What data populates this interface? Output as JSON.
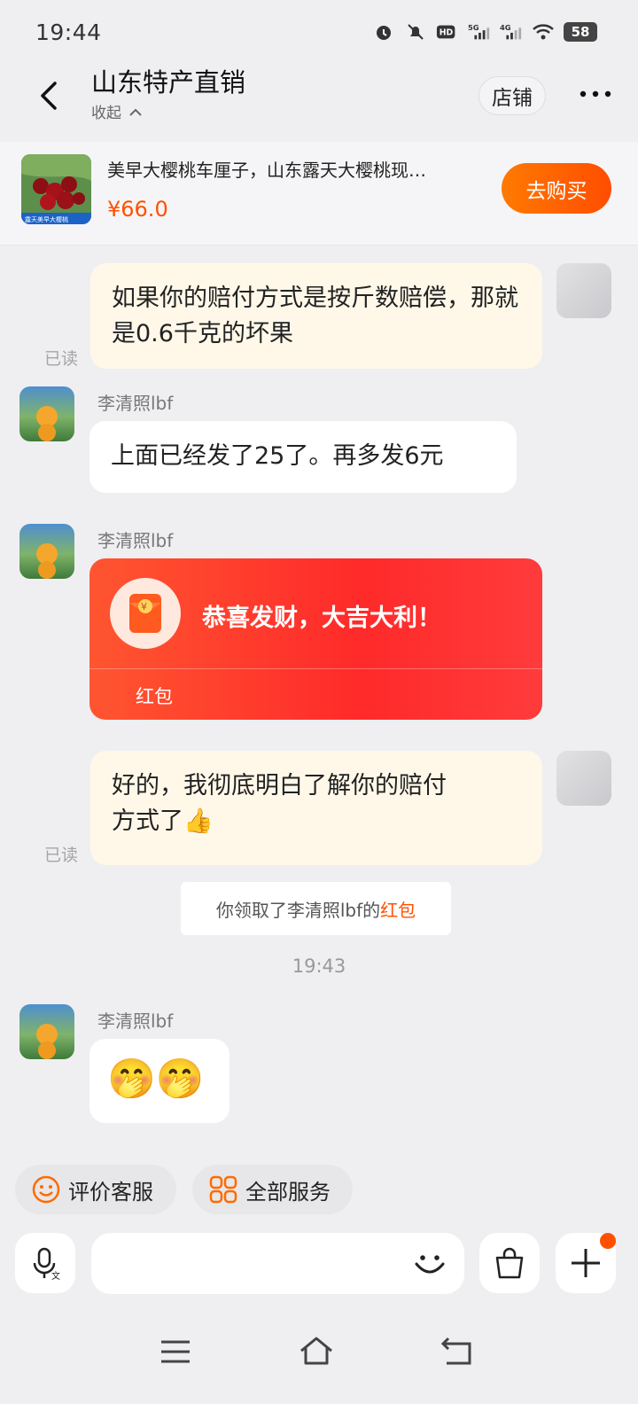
{
  "status": {
    "time": "19:44",
    "battery": "58",
    "net1": "5G",
    "net2": "4G"
  },
  "header": {
    "title": "山东特产直销",
    "subtitle": "收起",
    "shop_button": "店铺"
  },
  "product": {
    "name": "美早大樱桃车厘子，山东露天大樱桃现…",
    "price": "¥66.0",
    "buy_button": "去购买",
    "image_caption": "露天美早大樱桃"
  },
  "messages": {
    "m1": {
      "text": "如果你的赔付方式是按斤数赔偿，那就是0.6千克的坏果",
      "read": "已读"
    },
    "m2": {
      "sender": "李清照lbf",
      "text": "上面已经发了25了。再多发6元"
    },
    "m3": {
      "sender": "李清照lbf",
      "title": "恭喜发财，大吉大利！",
      "label": "红包",
      "icon": "yen-envelope-icon"
    },
    "m4": {
      "text_line1": "好的，我彻底明白了解你的赔付",
      "text_line2": "方式了",
      "emoji": "👍",
      "read": "已读"
    },
    "system": {
      "prefix": "你领取了李清照lbf的",
      "link": "红包"
    },
    "timestamp": "19:43",
    "m5": {
      "sender": "李清照lbf",
      "emoji": "🤭🤭"
    }
  },
  "services": {
    "rate": "评价客服",
    "all": "全部服务"
  },
  "colors": {
    "accent": "#ff5000",
    "red_packet": "#ff2a2a",
    "my_bubble": "#fff8e9"
  }
}
